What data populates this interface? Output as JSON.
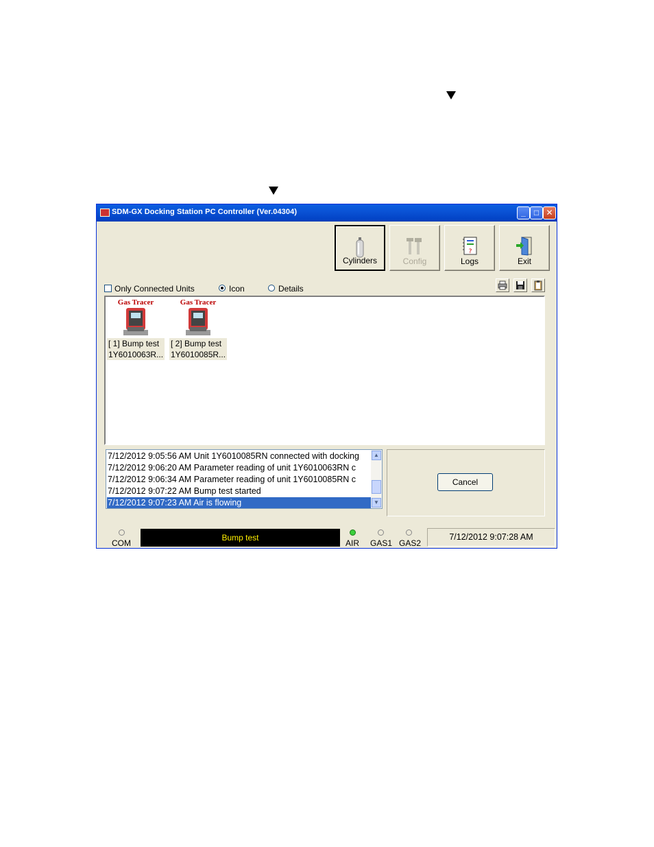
{
  "window": {
    "title": "SDM-GX Docking Station PC Controller (Ver.04304)"
  },
  "toolbar": {
    "buttons": [
      {
        "label": "Cylinders",
        "icon": "cylinder-icon",
        "enabled": true
      },
      {
        "label": "Config",
        "icon": "tools-icon",
        "enabled": false
      },
      {
        "label": "Logs",
        "icon": "logbook-icon",
        "enabled": true
      },
      {
        "label": "Exit",
        "icon": "exit-door-icon",
        "enabled": true
      }
    ]
  },
  "options": {
    "only_connected_label": "Only Connected Units",
    "only_connected_checked": false,
    "view_icon_label": "Icon",
    "view_details_label": "Details",
    "selected_view": "Icon"
  },
  "actions": {
    "icons": [
      "print-icon",
      "save-icon",
      "clipboard-icon"
    ]
  },
  "units": [
    {
      "brand": "Gas Tracer",
      "line1": "[ 1] Bump test",
      "line2": "1Y6010063R..."
    },
    {
      "brand": "Gas Tracer",
      "line1": "[ 2] Bump test",
      "line2": "1Y6010085R..."
    }
  ],
  "log": {
    "lines": [
      "7/12/2012 9:05:56 AM Unit 1Y6010085RN connected with docking",
      "7/12/2012 9:06:20 AM Parameter reading of unit 1Y6010063RN c",
      "7/12/2012 9:06:34 AM Parameter reading of unit 1Y6010085RN c",
      "7/12/2012 9:07:22 AM Bump test started",
      "7/12/2012 9:07:23 AM Air is flowing"
    ],
    "selected_index": 4
  },
  "panel": {
    "cancel_label": "Cancel"
  },
  "status": {
    "com_label": "COM",
    "message": "Bump test",
    "air_label": "AIR",
    "gas1_label": "GAS1",
    "gas2_label": "GAS2",
    "air_on": true,
    "datetime": "7/12/2012 9:07:28 AM"
  },
  "colors": {
    "titlebar": "#0a53d6",
    "selection": "#316ac5",
    "lcd_text": "#ffef00",
    "led_on": "#3ccf3c"
  }
}
